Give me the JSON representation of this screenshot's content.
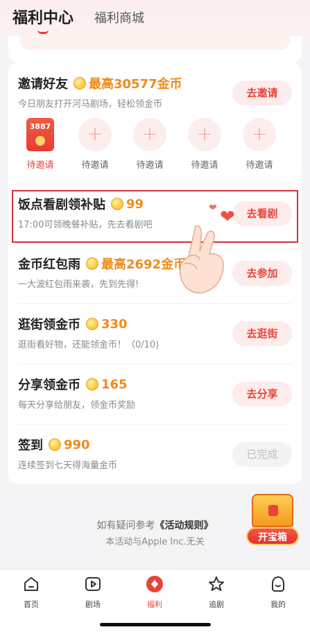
{
  "header": {
    "active_tab": "福利中心",
    "tab2": "福利商城"
  },
  "tasks": [
    {
      "title": "邀请好友",
      "reward": "最高30577金币",
      "sub": "今日朋友打开河马剧场，轻松领金币",
      "btn": "去邀请"
    },
    {
      "title": "饭点看剧领补贴",
      "reward": "99",
      "sub": "17:00可领晚餐补贴，先去看剧吧",
      "btn": "去看剧"
    },
    {
      "title": "金币红包雨",
      "reward": "最高2692金币",
      "sub": "一大波红包雨来袭，先到先得!",
      "btn": "去参加"
    },
    {
      "title": "逛街领金币",
      "reward": "330",
      "sub": "逛街看好物，还能领金币！（0/10)",
      "btn": "去逛街"
    },
    {
      "title": "分享领金币",
      "reward": "165",
      "sub": "每天分享给朋友，领金币奖励",
      "btn": "去分享"
    },
    {
      "title": "签到",
      "reward": "990",
      "sub": "连续签到七天得海量金币",
      "btn": "已完成"
    }
  ],
  "invite_slots": {
    "first_amount": "3887",
    "labels": [
      "待邀请",
      "待邀请",
      "待邀请",
      "待邀请",
      "待邀请"
    ],
    "plus": "+"
  },
  "footer": {
    "rules_prefix": "如有疑问参考",
    "rules_link": "《活动规则》",
    "disclaimer": "本活动与Apple Inc.无关"
  },
  "treasure": {
    "label": "开宝箱"
  },
  "tabbar": {
    "items": [
      "首页",
      "剧场",
      "福利",
      "追剧",
      "我的"
    ],
    "active_index": 2
  },
  "colors": {
    "accent": "#e8443a",
    "reward": "#f08a1c",
    "highlight_box": "#d3303a"
  },
  "icons": {
    "coin": "gold-coin-icon",
    "hand": "finger-heart-hand-icon",
    "heart": "heart-icon"
  }
}
